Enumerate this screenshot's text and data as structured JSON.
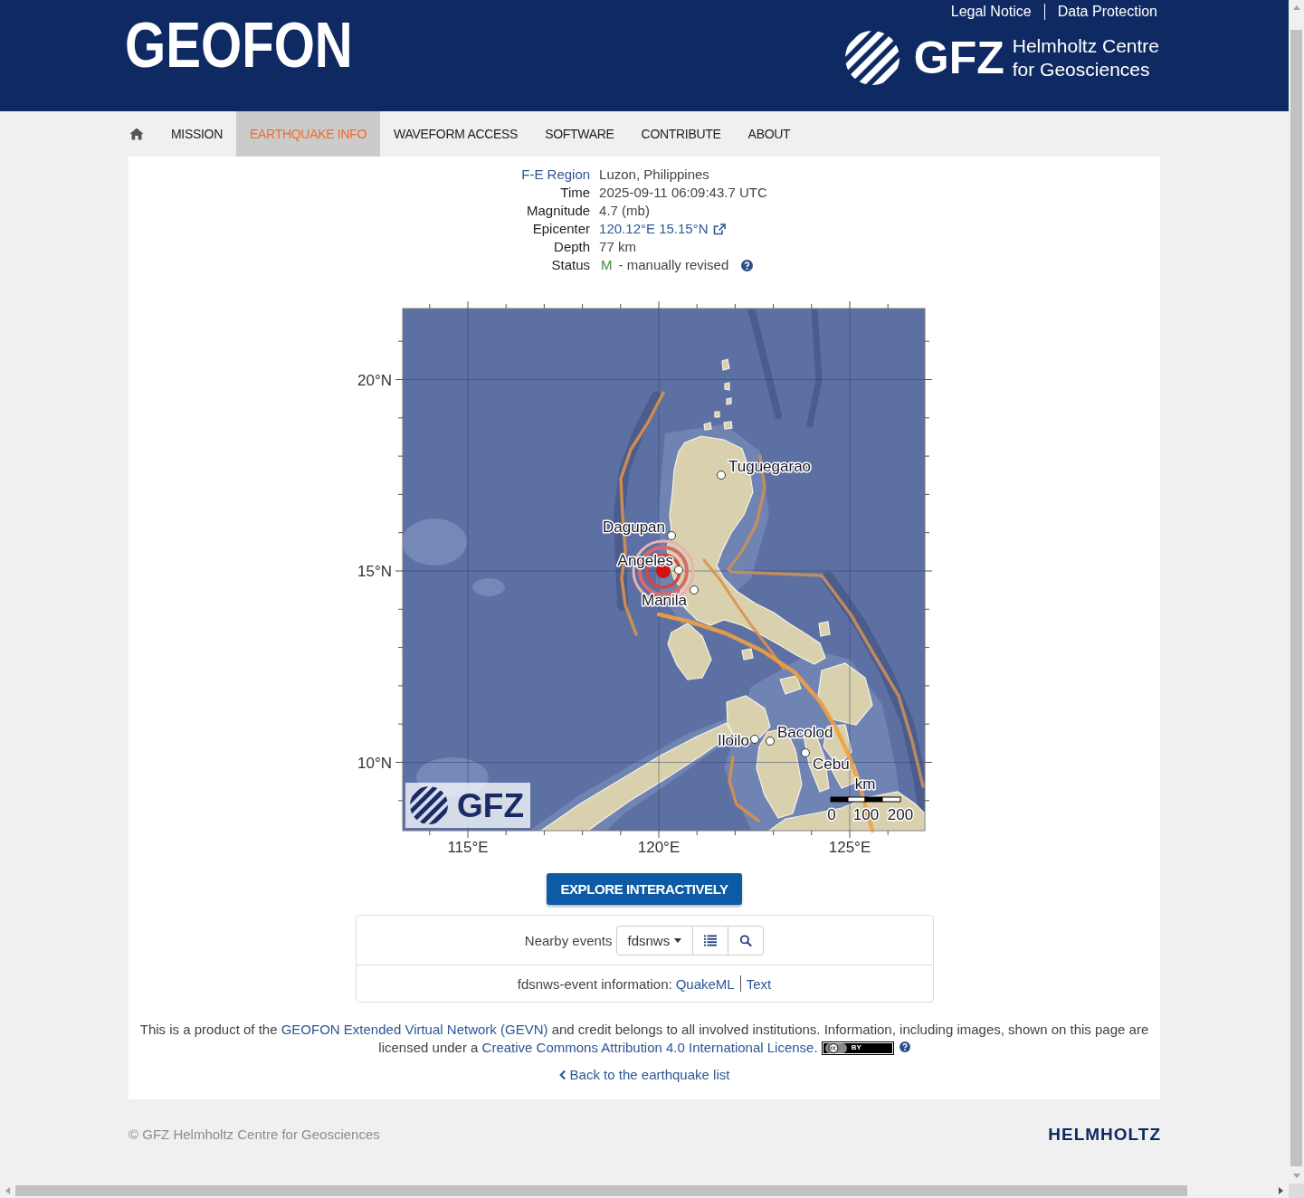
{
  "header": {
    "site_title": "GEOFON",
    "top_links": [
      "Legal Notice",
      "Data Protection"
    ],
    "org_logo": {
      "abbr": "GFZ",
      "name_lines": [
        "Helmholtz Centre",
        "for Geosciences"
      ]
    }
  },
  "nav": {
    "items": [
      {
        "label": "MISSION",
        "selected": false
      },
      {
        "label": "EARTHQUAKE INFO",
        "selected": true
      },
      {
        "label": "WAVEFORM ACCESS",
        "selected": false
      },
      {
        "label": "SOFTWARE",
        "selected": false
      },
      {
        "label": "CONTRIBUTE",
        "selected": false
      },
      {
        "label": "ABOUT",
        "selected": false
      }
    ]
  },
  "event": {
    "rows": [
      {
        "kind": "link-label",
        "label": "F-E Region",
        "value": "Luzon, Philippines"
      },
      {
        "kind": "plain",
        "label": "Time",
        "value": "2025-09-11 06:09:43.7 UTC"
      },
      {
        "kind": "plain",
        "label": "Magnitude",
        "value": "4.7 (mb)"
      },
      {
        "kind": "link-value",
        "label": "Epicenter",
        "value": "120.12°E 15.15°N"
      },
      {
        "kind": "plain",
        "label": "Depth",
        "value": "77 km"
      },
      {
        "kind": "status",
        "label": "Status",
        "code": "M",
        "value": "- manually revised"
      }
    ]
  },
  "map": {
    "lat_labels": [
      "20°N",
      "15°N",
      "10°N"
    ],
    "lon_labels": [
      "115°E",
      "120°E",
      "125°E"
    ],
    "cities": [
      "Tuguegarao",
      "Dagupan",
      "Angeles",
      "Manila",
      "Iloilo",
      "Bacolod",
      "Cebu"
    ],
    "scale_unit": "km",
    "scale_labels": [
      "0",
      "100",
      "200"
    ],
    "logo": "GFZ"
  },
  "explore_button": "EXPLORE INTERACTIVELY",
  "nearby": {
    "label": "Nearby events",
    "source": "fdsnws",
    "info_label": "fdsnws-event information:",
    "formats": [
      "QuakeML",
      "Text"
    ]
  },
  "credit": {
    "parts": [
      {
        "kind": "text",
        "text": "This is a product of the "
      },
      {
        "kind": "link",
        "text": "GEOFON Extended Virtual Network (GEVN)"
      },
      {
        "kind": "text",
        "text": " and credit belongs to all involved institutions. Information, including images, shown on this page are licensed under a "
      },
      {
        "kind": "link",
        "text": "Creative Commons Attribution 4.0 International License"
      },
      {
        "kind": "text",
        "text": "."
      }
    ],
    "badge": "BY"
  },
  "back_link": "Back to the earthquake list",
  "footer": {
    "copyright": "© GFZ Helmholtz Centre for Geosciences",
    "brand": "HELMHOLTZ"
  }
}
